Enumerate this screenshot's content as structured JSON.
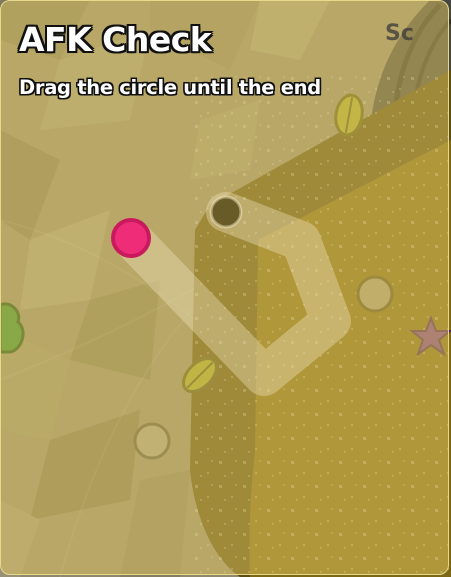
{
  "afk_check": {
    "title": "AFK Check",
    "instruction": "Drag the circle until the end"
  },
  "hud": {
    "corner_text_partial": "Sc"
  },
  "colors": {
    "overlay": "#e2c860",
    "title_text": "#ffffff",
    "text_outline": "#111111",
    "drag_handle": "#ee2c78",
    "drag_handle_ring": "#c91a5e",
    "path_track": "#f1e6bf",
    "end_ring": "#5a4c1c",
    "terrain_light": "#9b9378",
    "terrain_dark": "#5a4f1f",
    "ramp": "#7c6715",
    "ramp_edge": "#5c4c10",
    "leaf": "#a4a32c",
    "starfish": "#7b3c86",
    "bush": "#2f8a2c"
  },
  "icons": {
    "handle": "circle-handle-icon",
    "end": "ring-target-icon",
    "leaf_1": "leaf-icon",
    "leaf_2": "leaf-icon",
    "starfish": "starfish-icon",
    "bush": "bush-icon",
    "rock": "rock-icon",
    "pebble_1": "pebble-icon",
    "pebble_2": "pebble-icon"
  }
}
